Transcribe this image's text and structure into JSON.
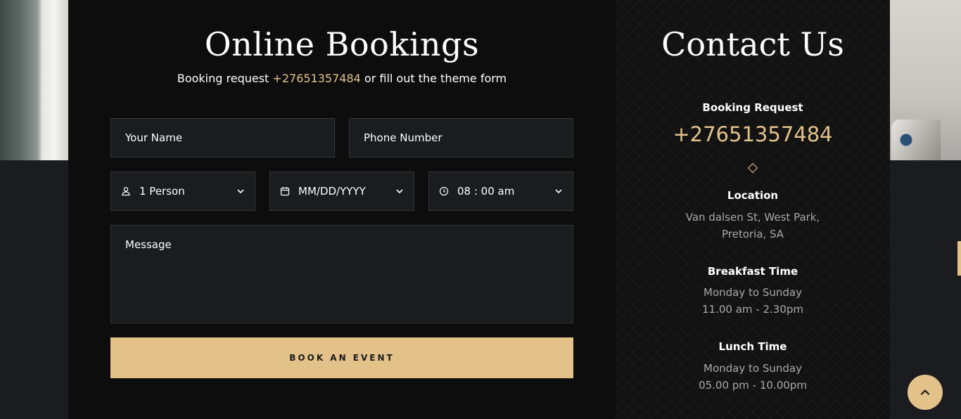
{
  "booking": {
    "title": "Online Bookings",
    "subtitle_prefix": "Booking request",
    "subtitle_phone": "+27651357484",
    "subtitle_suffix": "or fill out the theme form",
    "name_placeholder": "Your Name",
    "phone_placeholder": "Phone Number",
    "person_value": "1 Person",
    "date_value": "MM/DD/YYYY",
    "time_value": "08 : 00 am",
    "message_placeholder": "Message",
    "submit_label": "BOOK AN EVENT"
  },
  "contact": {
    "title": "Contact Us",
    "booking_label": "Booking Request",
    "booking_phone": "+27651357484",
    "location_label": "Location",
    "location_line1": "Van dalsen St, West Park,",
    "location_line2": "Pretoria, SA",
    "breakfast_label": "Breakfast Time",
    "breakfast_days": "Monday to Sunday",
    "breakfast_hours": "11.00 am - 2.30pm",
    "lunch_label": "Lunch Time",
    "lunch_days": "Monday to Sunday",
    "lunch_hours": "05.00 pm - 10.00pm"
  },
  "colors": {
    "accent": "#e3c28a",
    "panel_bg": "#0e0d0d",
    "field_bg": "#1b1c1f"
  },
  "icons": {
    "person": "user-icon",
    "date": "calendar-icon",
    "time": "clock-icon",
    "dropdown": "chevron-down-icon",
    "scroll": "chevron-up-icon"
  }
}
